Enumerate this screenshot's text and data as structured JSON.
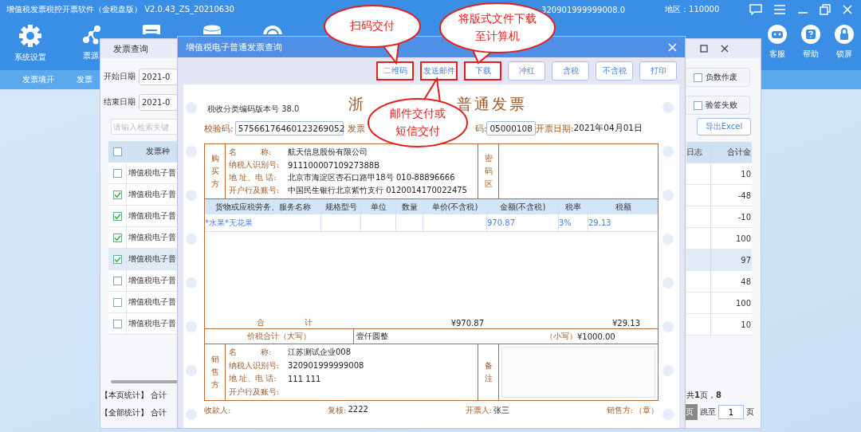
{
  "app": {
    "title": "增值税发票税控开票软件（金税盘版） V2.0.43_ZS_20210630",
    "account": "320901999999008.0",
    "region": "地区：110000"
  },
  "toolbar": {
    "left": [
      {
        "kind": "gear",
        "label": "系统设置"
      },
      {
        "kind": "nodes",
        "label": "票源"
      },
      {
        "kind": "document"
      },
      {
        "kind": "cylinder"
      },
      {
        "kind": "globe"
      }
    ],
    "right": [
      {
        "kind": "robot",
        "label": "客服"
      },
      {
        "kind": "help",
        "label": "帮助"
      },
      {
        "kind": "lock",
        "label": "锁屏"
      }
    ]
  },
  "subnav": [
    "发票填开",
    "发票"
  ],
  "query_window": {
    "title": "发票查询",
    "start_label": "开始日期",
    "start_value": "2021-0",
    "end_label": "结束日期",
    "end_value": "2021-0",
    "search_placeholder": "请输入检索关键",
    "header_checked": false,
    "columns": [
      "发票种",
      "日志",
      "合计金"
    ],
    "rows": [
      {
        "checked": false,
        "selected": false,
        "type": "增值税电子普",
        "total": "10"
      },
      {
        "checked": true,
        "selected": false,
        "type": "增值税电子普",
        "total": "-48"
      },
      {
        "checked": true,
        "selected": false,
        "type": "增值税电子普",
        "total": "-10"
      },
      {
        "checked": true,
        "selected": false,
        "type": "增值税电子普",
        "total": "100"
      },
      {
        "checked": true,
        "selected": true,
        "type": "增值税电子普",
        "total": "97"
      },
      {
        "checked": false,
        "selected": false,
        "type": "增值税电子普",
        "total": "48"
      },
      {
        "checked": false,
        "selected": false,
        "type": "增值税电子普",
        "total": "100"
      },
      {
        "checked": false,
        "selected": false,
        "type": "增值税电子普",
        "total": "10"
      }
    ],
    "filters": [
      {
        "label": "负数作废",
        "checked": false
      },
      {
        "label": "验签失败",
        "checked": false
      }
    ],
    "export_button": "导出Excel",
    "page_stats": "【本页统计】 合计",
    "all_stats": "【全部统计】 合计",
    "pager": "共**1**页，**8**",
    "pager_prev": "页",
    "jump_label": "跳至",
    "jump_value": "1",
    "jump_unit": "页"
  },
  "invoice_dialog": {
    "title": "增值税电子普通发票查询",
    "buttons": [
      {
        "label": "二维码",
        "highlighted": true
      },
      {
        "label": "发送邮件",
        "highlighted": true
      },
      {
        "label": "下载",
        "highlighted": true
      },
      {
        "label": "冲红",
        "highlighted": false
      },
      {
        "label": "含税",
        "highlighted": false
      },
      {
        "label": "不含税",
        "highlighted": false
      },
      {
        "label": "打印",
        "highlighted": false
      }
    ],
    "invoice": {
      "title_parts": [
        "浙",
        "普通发票"
      ],
      "version": "税收分类编码版本号  38.0",
      "check_code_label": "校验码:",
      "check_code": "57566176460123269052",
      "code_label": "发票",
      "number_label": "码:",
      "number": "05000108",
      "date_label": "开票日期:",
      "date": "2021年04月01日",
      "buyer": {
        "side": "购买方",
        "fields": [
          {
            "label": "名　　　称:",
            "value": "航天信息股份有限公司"
          },
          {
            "label": "纳税人识别号:",
            "value": "91110000710927388B"
          },
          {
            "label": "地 址、电 话:",
            "value": "北京市海淀区杏石口路甲18号 010-88896666"
          },
          {
            "label": "开户行及账号:",
            "value": "中国民生银行北京紫竹支行 0120014170022475"
          }
        ],
        "cipher_label": "密码区"
      },
      "item_columns": [
        "货物或应税劳务、服务名称",
        "规格型号",
        "单位",
        "数量",
        "单价(不含税)",
        "金额(不含税)",
        "税率",
        "税额"
      ],
      "items": [
        {
          "name": "*水果*无花果",
          "amount": "970.87",
          "rate": "3%",
          "tax": "29.13"
        }
      ],
      "total_label": "合　　　　　计",
      "total_amount": "¥970.87",
      "total_tax": "¥29.13",
      "sum_label": "价税合计（大写）",
      "sum_words": "壹仟圆整",
      "sum_small_label": "（小写）",
      "sum_small": "¥1000.00",
      "seller": {
        "side": "销售方",
        "fields": [
          {
            "label": "名　　　称:",
            "value": "江苏测试企业008"
          },
          {
            "label": "纳税人识别号:",
            "value": "320901999999008"
          },
          {
            "label": "地 址、电 话:",
            "value": "111 111"
          },
          {
            "label": "开户行及账号:"
          }
        ],
        "remark_label": "备注"
      },
      "footer": [
        {
          "label": "收款人:"
        },
        {
          "label": "复核:",
          "value": "2222"
        },
        {
          "label": "开票人:",
          "value": "张三"
        },
        {
          "label": "销售方:",
          "value": "（章）"
        }
      ]
    }
  },
  "callouts": [
    {
      "lines": [
        "扫码交付"
      ]
    },
    {
      "lines": [
        "将版式文件下载",
        "至计算机"
      ]
    },
    {
      "lines": [
        "邮件交付或",
        "短信交付"
      ]
    }
  ]
}
